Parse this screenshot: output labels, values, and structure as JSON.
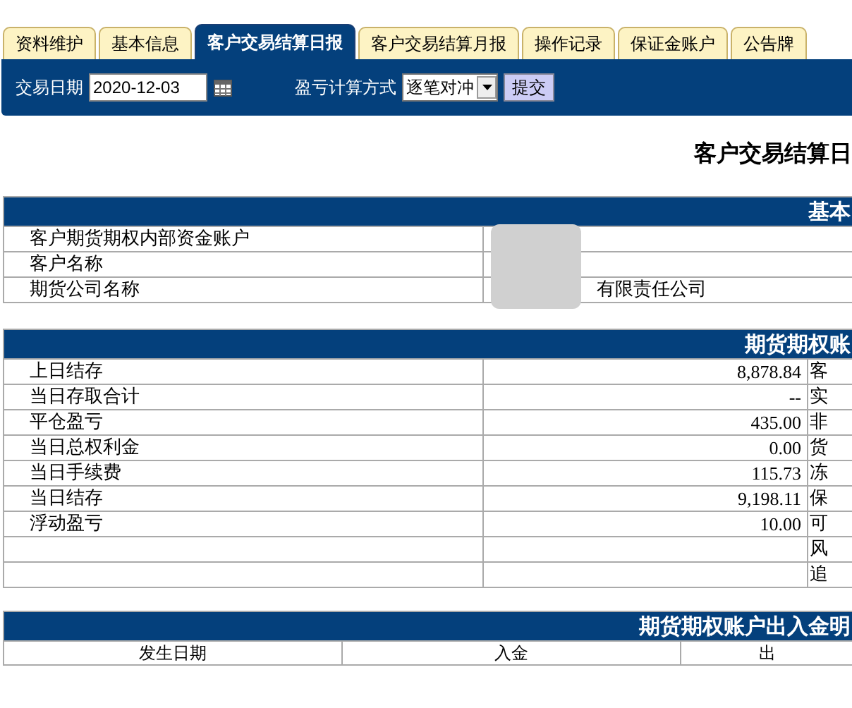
{
  "tabs": [
    {
      "label": "资料维护",
      "selected": false
    },
    {
      "label": "基本信息",
      "selected": false
    },
    {
      "label": "客户交易结算日报",
      "selected": true
    },
    {
      "label": "客户交易结算月报",
      "selected": false
    },
    {
      "label": "操作记录",
      "selected": false
    },
    {
      "label": "保证金账户",
      "selected": false
    },
    {
      "label": "公告牌",
      "selected": false
    }
  ],
  "toolbar": {
    "date_label": "交易日期",
    "date_value": "2020-12-03",
    "method_label": "盈亏计算方式",
    "method_value": "逐笔对冲",
    "submit": "提交"
  },
  "report_title": "客户交易结算日",
  "basic_info": {
    "header": "基本",
    "rows": [
      {
        "label": "客户期货期权内部资金账户",
        "value": ""
      },
      {
        "label": "客户名称",
        "value": ""
      },
      {
        "label": "期货公司名称",
        "value": "有限责任公司"
      }
    ]
  },
  "account": {
    "header": "期货期权账",
    "rows": [
      {
        "label": "上日结存",
        "value": "8,878.84",
        "column_3": "客"
      },
      {
        "label": "当日存取合计",
        "value": "--",
        "column_3": "实"
      },
      {
        "label": "平仓盈亏",
        "value": "435.00",
        "column_3": "非"
      },
      {
        "label": "当日总权利金",
        "value": "0.00",
        "column_3": "货"
      },
      {
        "label": "当日手续费",
        "value": "115.73",
        "column_3": "冻"
      },
      {
        "label": "当日结存",
        "value": "9,198.11",
        "column_3": "保"
      },
      {
        "label": "浮动盈亏",
        "value": "10.00",
        "column_3": "可"
      },
      {
        "label": "",
        "value": "",
        "column_3": "风"
      },
      {
        "label": "",
        "value": "",
        "column_3": "追"
      }
    ]
  },
  "cash_flow": {
    "header": "期货期权账户出入金明",
    "columns": [
      "发生日期",
      "入金",
      "出"
    ]
  }
}
